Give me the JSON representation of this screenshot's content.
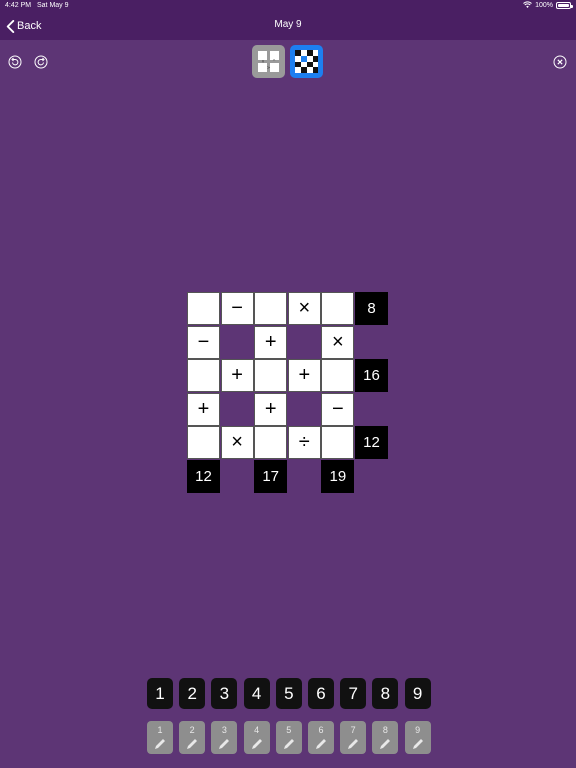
{
  "status": {
    "time": "4:42 PM",
    "date": "Sat May 9",
    "battery": "100%"
  },
  "nav": {
    "back_label": "Back",
    "title": "May 9"
  },
  "toolbar": {
    "undo_icon": "undo-icon",
    "redo_icon": "redo-icon",
    "close_icon": "close-icon",
    "mode_gray_icon": "grid-operators-icon",
    "mode_blue_icon": "grid-pattern-icon",
    "mode_blue_color": "#1d7ff0"
  },
  "puzzle": {
    "rows": [
      [
        "",
        "−",
        "",
        "×",
        "",
        "8"
      ],
      [
        "−",
        null,
        "+",
        null,
        "×",
        null
      ],
      [
        "",
        "+",
        "",
        "+",
        "",
        "16"
      ],
      [
        "+",
        null,
        "+",
        null,
        "−",
        null
      ],
      [
        "",
        "×",
        "",
        "÷",
        "",
        "12"
      ],
      [
        "12",
        null,
        "17",
        null,
        "19",
        null
      ]
    ]
  },
  "number_pad": [
    "1",
    "2",
    "3",
    "4",
    "5",
    "6",
    "7",
    "8",
    "9"
  ],
  "notes_pad": [
    "1",
    "2",
    "3",
    "4",
    "5",
    "6",
    "7",
    "8",
    "9"
  ],
  "colors": {
    "background": "#5d3575",
    "nav": "#4a1f63",
    "accent": "#1d7ff0"
  }
}
